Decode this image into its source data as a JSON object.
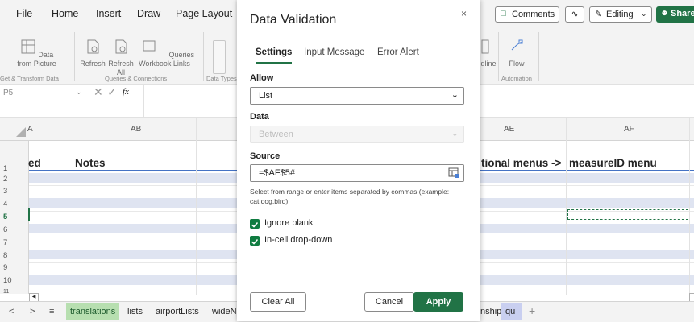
{
  "menu": {
    "tabs": [
      "File",
      "Home",
      "Insert",
      "Draw",
      "Page Layout"
    ]
  },
  "top_right": {
    "comments": "Comments",
    "editing": "Editing",
    "share": "Share"
  },
  "ribbon": {
    "data_from_picture": "Data from Picture",
    "refresh": "Refresh",
    "refresh_all": "Refresh All",
    "queries_workbook_links": "Queries Workbook Links",
    "outline_frag": "dline",
    "flow": "Flow",
    "group_get_transform": "Get & Transform Data",
    "group_queries": "Queries & Connections",
    "group_data_types": "Data Types",
    "group_automation": "Automation"
  },
  "formula_bar": {
    "cell_ref": "P5",
    "fx": "fx"
  },
  "grid": {
    "columns": [
      "A",
      "AB",
      "AE",
      "AF"
    ],
    "rows": [
      "1",
      "2",
      "3",
      "4",
      "5",
      "6",
      "7",
      "8",
      "9",
      "10",
      "11"
    ],
    "cells": {
      "a1": "ed",
      "ab1": "Notes",
      "ae1": "tional menus ->",
      "af1": "measureID menu"
    }
  },
  "sheets": {
    "tabs": [
      "translations",
      "lists",
      "airportLists",
      "wideNa"
    ],
    "right_tabs": [
      "nships",
      "qu"
    ],
    "add": "+"
  },
  "dialog": {
    "title": "Data Validation",
    "close": "×",
    "tabs": [
      "Settings",
      "Input Message",
      "Error Alert"
    ],
    "allow_label": "Allow",
    "allow_value": "List",
    "data_label": "Data",
    "data_value": "Between",
    "source_label": "Source",
    "source_value": "=$AF$5#",
    "hint": "Select from range or enter items separated by commas (example: cat,dog,bird)",
    "ignore_blank": "Ignore blank",
    "in_cell_dropdown": "In-cell drop-down",
    "clear_all": "Clear All",
    "cancel": "Cancel",
    "apply": "Apply"
  },
  "colors": {
    "accent": "#217346",
    "selection_band": "#dfe4f1",
    "header_line": "#4472c4"
  }
}
